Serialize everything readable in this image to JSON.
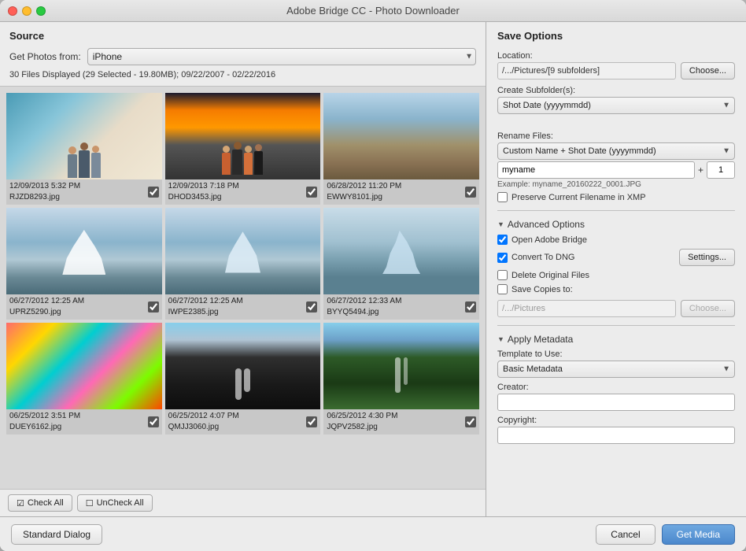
{
  "window": {
    "title": "Adobe Bridge CC - Photo Downloader"
  },
  "source_section": {
    "title": "Source",
    "get_photos_label": "Get Photos from:",
    "source_value": "iPhone",
    "file_info": "30 Files Displayed (29 Selected - 19.80MB); 09/22/2007 - 02/22/2016"
  },
  "photos": [
    {
      "date": "12/09/2013 5:32 PM",
      "filename": "RJZD8293.jpg",
      "checked": true,
      "type": "group"
    },
    {
      "date": "12/09/2013 7:18 PM",
      "filename": "DHOD3453.jpg",
      "checked": true,
      "type": "group2"
    },
    {
      "date": "06/28/2012 11:20 PM",
      "filename": "EWWY8101.jpg",
      "checked": true,
      "type": "landscape"
    },
    {
      "date": "06/27/2012 12:25 AM",
      "filename": "UPRZ5290.jpg",
      "checked": true,
      "type": "iceberg"
    },
    {
      "date": "06/27/2012 12:25 AM",
      "filename": "IWPE2385.jpg",
      "checked": true,
      "type": "iceberg2"
    },
    {
      "date": "06/27/2012 12:33 AM",
      "filename": "BYYQ5494.jpg",
      "checked": true,
      "type": "iceberg3"
    },
    {
      "date": "06/25/2012 3:51 PM",
      "filename": "DUEY6162.jpg",
      "checked": true,
      "type": "colorful"
    },
    {
      "date": "06/25/2012 4:07 PM",
      "filename": "QMJJ3060.jpg",
      "checked": true,
      "type": "waterfall1"
    },
    {
      "date": "06/25/2012 4:30 PM",
      "filename": "JQPV2582.jpg",
      "checked": true,
      "type": "waterfall2"
    }
  ],
  "bottom_buttons": {
    "check_all": "Check All",
    "uncheck_all": "UnCheck All"
  },
  "save_options": {
    "title": "Save Options",
    "location_label": "Location:",
    "location_path": "/.../Pictures/[9 subfolders]",
    "choose_label": "Choose...",
    "create_subfolder_label": "Create Subfolder(s):",
    "subfolder_value": "Shot Date (yyyymmdd)",
    "rename_files_label": "Rename Files:",
    "rename_method": "Custom Name + Shot Date (yyyymmdd)",
    "rename_input_value": "myname",
    "rename_plus": "+",
    "rename_number": "1",
    "example_text": "Example: myname_20160222_0001.JPG",
    "preserve_xmp_label": "Preserve Current Filename in XMP"
  },
  "advanced_options": {
    "title": "Advanced Options",
    "open_bridge_label": "Open Adobe Bridge",
    "open_bridge_checked": true,
    "convert_dng_label": "Convert To DNG",
    "convert_dng_checked": true,
    "settings_label": "Settings...",
    "delete_originals_label": "Delete Original Files",
    "delete_originals_checked": false,
    "save_copies_label": "Save Copies to:",
    "save_copies_checked": false,
    "copies_path": "/.../Pictures",
    "choose_copies_label": "Choose..."
  },
  "apply_metadata": {
    "title": "Apply Metadata",
    "template_label": "Template to Use:",
    "template_value": "Basic Metadata",
    "creator_label": "Creator:",
    "creator_value": "",
    "copyright_label": "Copyright:",
    "copyright_value": ""
  },
  "footer": {
    "standard_dialog": "Standard Dialog",
    "cancel": "Cancel",
    "get_media": "Get Media"
  }
}
